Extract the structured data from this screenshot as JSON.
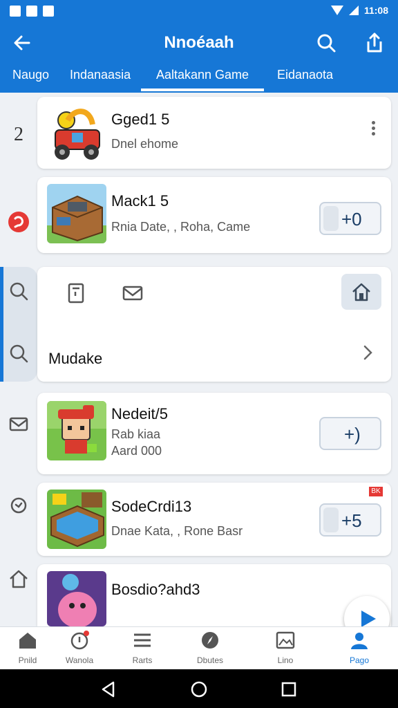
{
  "status": {
    "time": "11:08"
  },
  "appbar": {
    "title": "Nnoéaah"
  },
  "tabs": [
    {
      "label": "Naugo"
    },
    {
      "label": "Indanaasia"
    },
    {
      "label": "Aaltakann Game"
    },
    {
      "label": "Eidanaota"
    }
  ],
  "rail": {
    "number": "2"
  },
  "cards": [
    {
      "name": "Gged1 5",
      "sub": "Dnel ehome"
    },
    {
      "name": "Mack1 5",
      "sub": "Rnia Date, , Roha, Came",
      "stepper": "+0"
    },
    {
      "section_label": "Mudake"
    },
    {
      "name": "Nedeit/5",
      "sub": "Rab kiaa",
      "sub2": "Aard 000",
      "stepper": "+)"
    },
    {
      "name": "SodeCrdi13",
      "sub": "Dnae Kata, , Rone Basr",
      "stepper": "+5",
      "badge": "BK"
    },
    {
      "name": "Bosdio?ahd3"
    }
  ],
  "bottomnav": [
    {
      "label": "Pnild"
    },
    {
      "label": "Wanola"
    },
    {
      "label": "Rarts"
    },
    {
      "label": "Dbutes"
    },
    {
      "label": "Lino"
    },
    {
      "label": "Pago"
    }
  ],
  "colors": {
    "primary": "#1677d6",
    "background": "#eef1f5",
    "badge": "#e53935"
  }
}
